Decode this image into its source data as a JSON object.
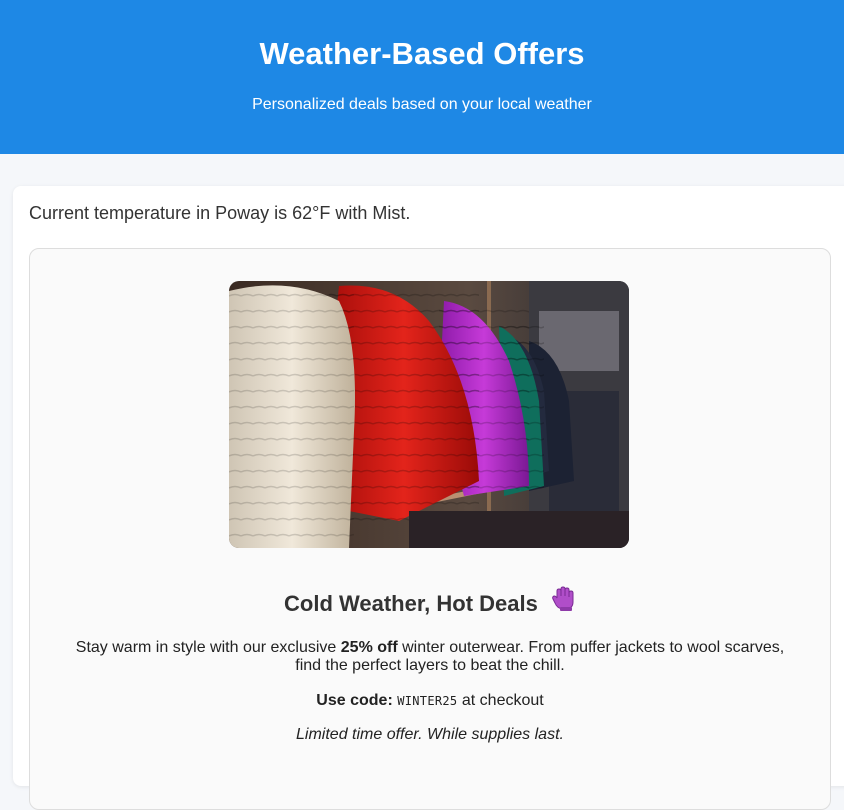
{
  "header": {
    "title": "Weather-Based Offers",
    "subtitle": "Personalized deals based on your local weather",
    "background_color": "#1e88e5"
  },
  "weather": {
    "summary": "Current temperature in Poway is 62°F with Mist."
  },
  "offer": {
    "image_alt": "Rack of colorful puffer jackets",
    "title": "Cold Weather, Hot Deals",
    "title_icon": "gloves-icon",
    "description_pre": "Stay warm in style with our exclusive ",
    "description_bold": "25% off",
    "description_post": " winter outerwear. From puffer jackets to wool scarves, find the perfect layers to beat the chill.",
    "code_label": "Use code:",
    "code_value": "WINTER25",
    "code_suffix": "at checkout",
    "note": "Limited time offer. While supplies last."
  }
}
